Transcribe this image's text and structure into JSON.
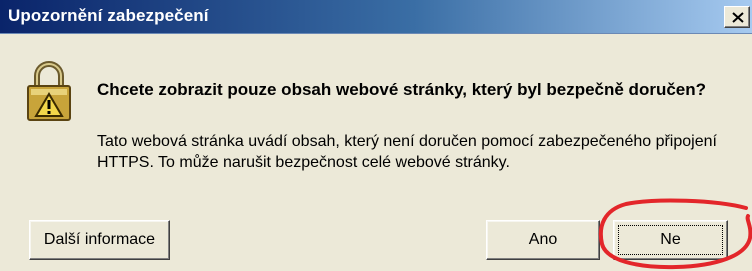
{
  "dialog": {
    "title": "Upozornění zabezpečení",
    "heading": "Chcete zobrazit pouze obsah webové stránky, který byl bezpečně doručen?",
    "body": "Tato webová stránka uvádí obsah, který není doručen pomocí zabezpečeného připojení HTTPS. To může narušit bezpečnost celé webové stránky.",
    "buttons": {
      "more_info": "Další informace",
      "yes": "Ano",
      "no": "Ne"
    }
  },
  "icons": {
    "close": "close-icon",
    "lock": "padlock-warning-icon"
  },
  "colors": {
    "titlebar_dark": "#0a246a",
    "titlebar_light": "#a6caf0",
    "dialog_bg": "#ece9d8",
    "annotation_red": "#e3262a"
  }
}
